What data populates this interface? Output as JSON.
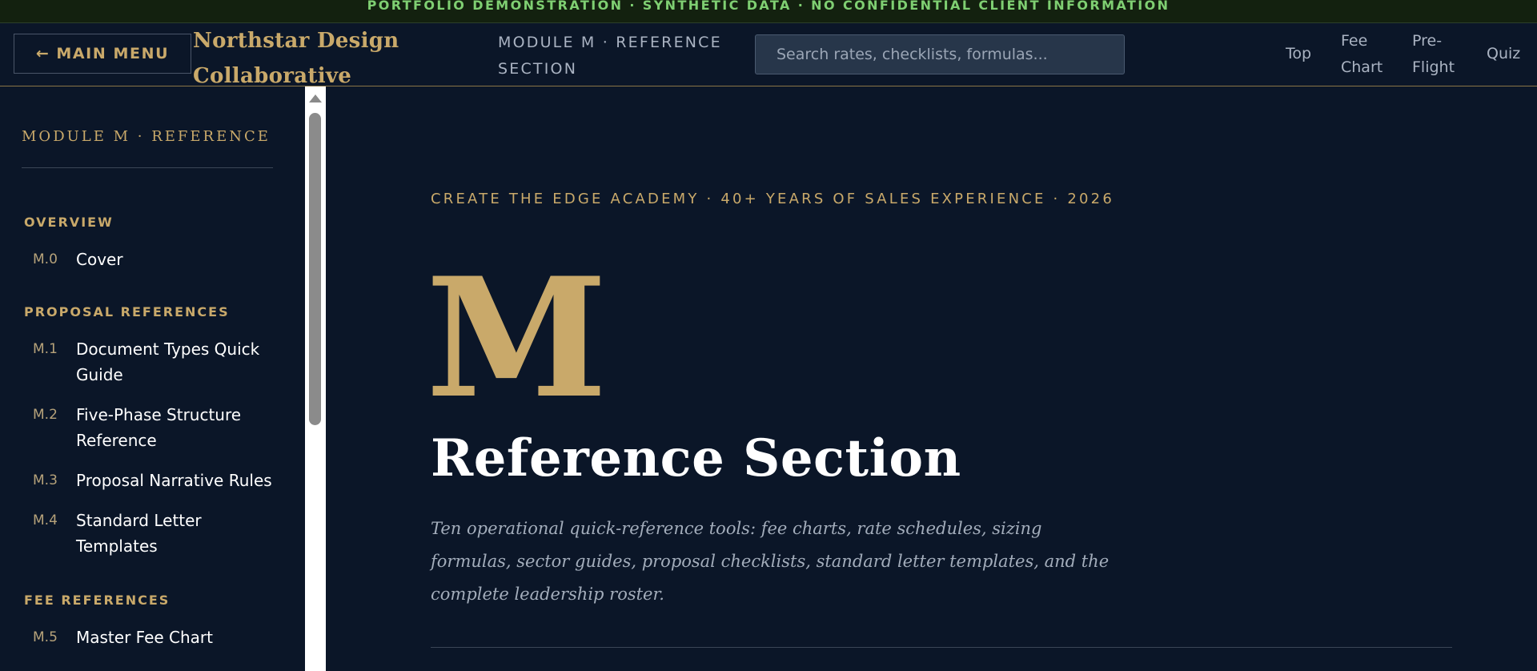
{
  "banner": {
    "text": "PORTFOLIO DEMONSTRATION  ·  SYNTHETIC DATA  ·  NO CONFIDENTIAL CLIENT INFORMATION"
  },
  "header": {
    "main_menu_label": "MAIN MENU",
    "main_menu_arrow": "←",
    "brand_line1": "Northstar Design",
    "brand_line2": "Collaborative",
    "module_line1": "MODULE M · REFERENCE",
    "module_line2": "SECTION",
    "search_placeholder": "Search rates, checklists, formulas...",
    "nav": {
      "top": "Top",
      "fee_line1": "Fee",
      "fee_line2": "Chart",
      "preflight_line1": "Pre-",
      "preflight_line2": "Flight",
      "quiz": "Quiz"
    }
  },
  "sidebar": {
    "title": "MODULE M · REFERENCE",
    "groups": [
      {
        "label": "OVERVIEW"
      },
      {
        "label": "PROPOSAL REFERENCES"
      },
      {
        "label": "FEE REFERENCES"
      }
    ],
    "items": [
      {
        "num": "M.0",
        "label": "Cover"
      },
      {
        "num": "M.1",
        "label": "Document Types Quick Guide"
      },
      {
        "num": "M.2",
        "label": "Five-Phase Structure Reference"
      },
      {
        "num": "M.3",
        "label": "Proposal Narrative Rules"
      },
      {
        "num": "M.4",
        "label": "Standard Letter Templates"
      },
      {
        "num": "M.5",
        "label": "Master Fee Chart"
      }
    ]
  },
  "main": {
    "eyebrow": "CREATE THE EDGE ACADEMY · 40+ YEARS OF SALES EXPERIENCE · 2026",
    "letter": "M",
    "title": "Reference Section",
    "intro": "Ten operational quick-reference tools: fee charts, rate schedules, sizing formulas, sector guides, proposal checklists, standard letter templates, and the complete leadership roster."
  },
  "colors": {
    "background": "#0b1628",
    "accent_gold": "#c9a96a",
    "banner_green": "#7fcf72"
  }
}
